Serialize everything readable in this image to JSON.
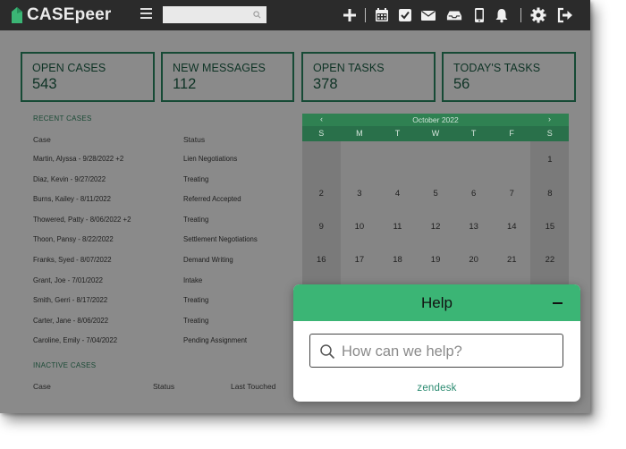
{
  "app": {
    "brand": "CASEpeer",
    "accent_color": "#3bb575",
    "dark_green": "#164a35"
  },
  "topbar": {
    "search_placeholder": "",
    "icons": [
      "plus-icon",
      "calendar-icon",
      "checkbox-icon",
      "mail-icon",
      "inbox-icon",
      "phone-icon",
      "bell-icon",
      "gear-icon",
      "logout-icon"
    ]
  },
  "stats": [
    {
      "label": "OPEN CASES",
      "value": "543"
    },
    {
      "label": "NEW MESSAGES",
      "value": "112"
    },
    {
      "label": "OPEN TASKS",
      "value": "378"
    },
    {
      "label": "TODAY'S TASKS",
      "value": "56"
    }
  ],
  "recent_cases": {
    "title": "RECENT CASES",
    "columns": [
      "Case",
      "Status"
    ],
    "rows": [
      {
        "name": "Martin, Alyssa - 9/28/2022 +2",
        "status": "Lien Negotiations"
      },
      {
        "name": "Diaz, Kevin - 9/27/2022",
        "status": "Treating"
      },
      {
        "name": "Burns, Kailey - 8/11/2022",
        "status": "Referred Accepted"
      },
      {
        "name": "Thowered, Patty - 8/06/2022 +2",
        "status": "Treating"
      },
      {
        "name": "Thoon, Pansy - 8/22/2022",
        "status": "Settlement Negotiations"
      },
      {
        "name": "Franks, Syed - 8/07/2022",
        "status": "Demand Writing"
      },
      {
        "name": "Grant, Joe - 7/01/2022",
        "status": "Intake"
      },
      {
        "name": "Smith, Gerri - 8/17/2022",
        "status": "Treating"
      },
      {
        "name": "Carter, Jane - 8/06/2022",
        "status": "Treating"
      },
      {
        "name": "Caroline, Emily - 7/04/2022",
        "status": "Pending Assignment"
      }
    ]
  },
  "inactive_cases": {
    "title": "INACTIVE CASES",
    "columns": [
      "Case",
      "Status",
      "Last Touched"
    ]
  },
  "calendar": {
    "month": "October 2022",
    "prev": "‹",
    "next": "›",
    "weekdays": [
      "S",
      "M",
      "T",
      "W",
      "T",
      "F",
      "S"
    ],
    "rows": [
      [
        "",
        "",
        "",
        "",
        "",
        "",
        "1"
      ],
      [
        "2",
        "3",
        "4",
        "5",
        "6",
        "7",
        "8"
      ],
      [
        "9",
        "10",
        "11",
        "12",
        "13",
        "14",
        "15"
      ],
      [
        "16",
        "17",
        "18",
        "19",
        "20",
        "21",
        "22"
      ]
    ]
  },
  "help": {
    "title": "Help",
    "search_placeholder": "How can we help?",
    "footer": "zendesk"
  }
}
